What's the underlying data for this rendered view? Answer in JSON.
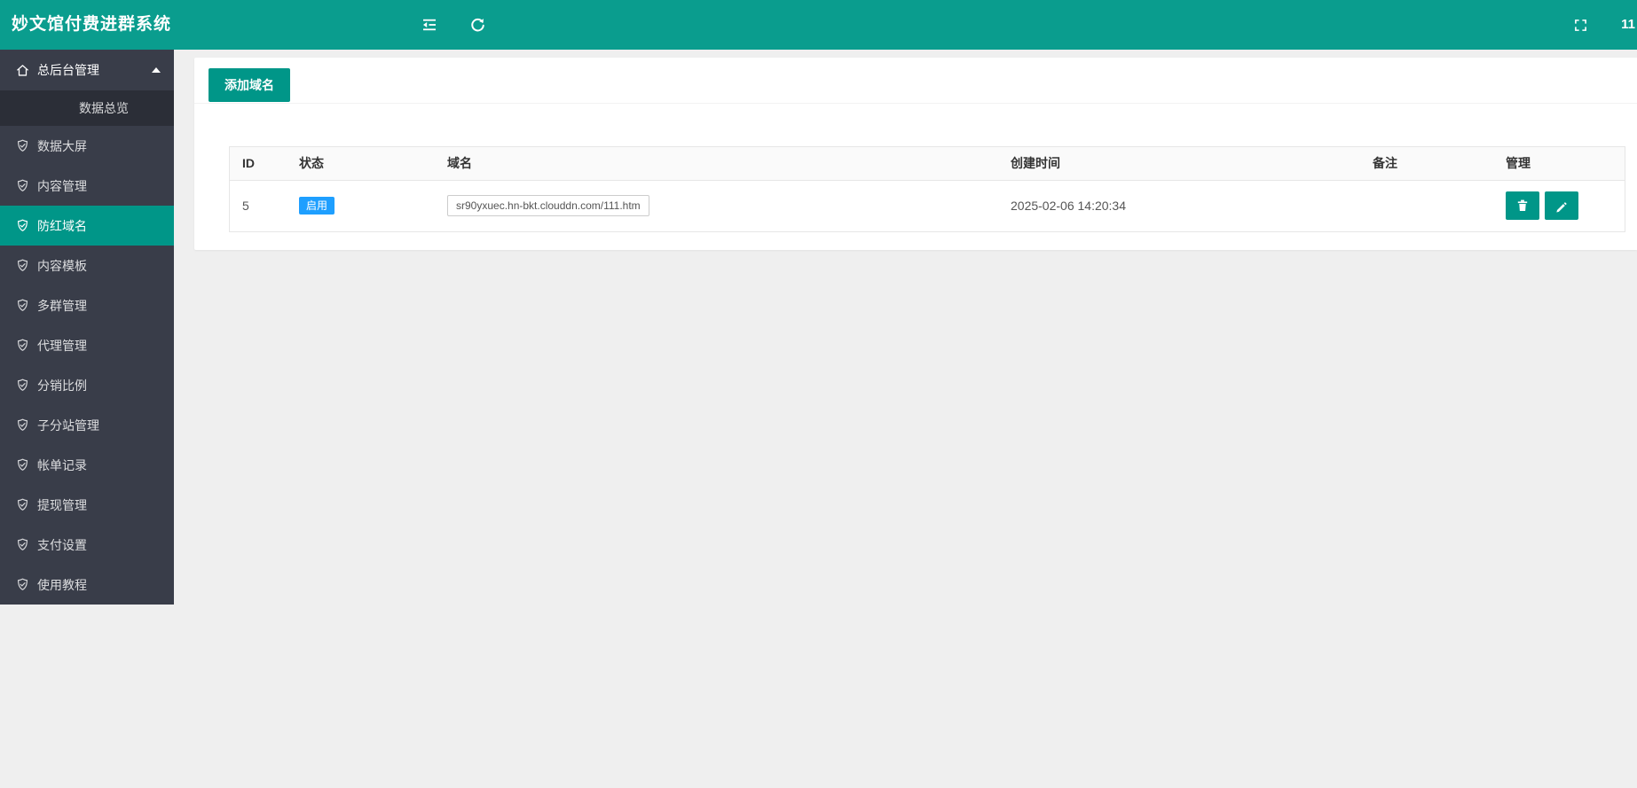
{
  "topbar": {
    "title": "妙文馆付费进群系统",
    "user_text": "11"
  },
  "sidebar": {
    "items": [
      {
        "label": "总后台管理",
        "icon": "home",
        "expanded": true
      },
      {
        "label": "数据总览",
        "type": "child"
      },
      {
        "label": "数据大屏",
        "icon": "shield-check"
      },
      {
        "label": "内容管理",
        "icon": "shield-check"
      },
      {
        "label": "防红域名",
        "icon": "shield-check",
        "active": true
      },
      {
        "label": "内容模板",
        "icon": "shield-check"
      },
      {
        "label": "多群管理",
        "icon": "shield-check"
      },
      {
        "label": "代理管理",
        "icon": "shield-check"
      },
      {
        "label": "分销比例",
        "icon": "shield-check"
      },
      {
        "label": "子分站管理",
        "icon": "shield-check"
      },
      {
        "label": "帐单记录",
        "icon": "shield-check"
      },
      {
        "label": "提现管理",
        "icon": "shield-check"
      },
      {
        "label": "支付设置",
        "icon": "shield-check"
      },
      {
        "label": "使用教程",
        "icon": "shield-check"
      }
    ]
  },
  "toolbar": {
    "add_button": "添加域名"
  },
  "table": {
    "columns": [
      "ID",
      "状态",
      "域名",
      "创建时间",
      "备注",
      "管理"
    ],
    "rows": [
      {
        "id": "5",
        "status": "启用",
        "domain": "sr90yxuec.hn-bkt.clouddn.com/111.htm",
        "created": "2025-02-06 14:20:34",
        "remark": ""
      }
    ]
  },
  "icons": {
    "header_left": [
      "outdent-icon",
      "refresh-icon"
    ],
    "header_right": [
      "fullscreen-icon"
    ],
    "row_actions": [
      "trash-icon",
      "pencil-icon"
    ]
  },
  "colors": {
    "header_bg": "#0a9d8e",
    "sidebar_bg": "#393d49",
    "sidebar_sub_bg": "#2b2e37",
    "primary": "#009688",
    "status_badge": "#1e9fff",
    "page_bg": "#efefef",
    "table_border": "#e6e6e6",
    "table_head_bg": "#fafafa"
  }
}
